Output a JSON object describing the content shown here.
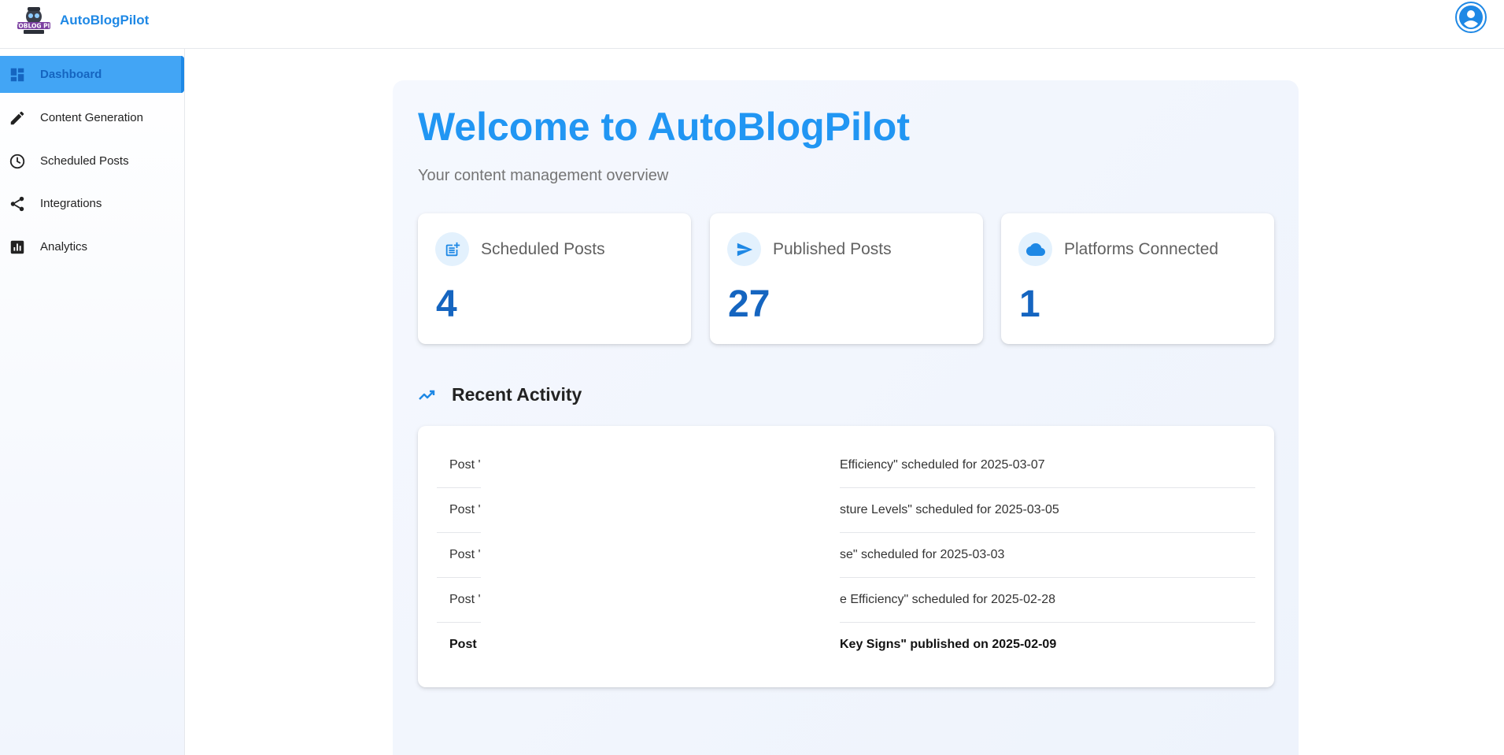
{
  "app": {
    "name": "AutoBlogPilot",
    "logo_text": "AUTOBLOG PILOT"
  },
  "icons": {
    "logo": "robot-pilot-logo",
    "account": "account-circle-icon",
    "dashboard": "dashboard-icon",
    "content_generation": "pencil-icon",
    "scheduled_posts": "clock-icon",
    "integrations": "share-icon",
    "analytics": "analytics-icon",
    "scheduled_stat": "post-add-icon",
    "published_stat": "send-icon",
    "platforms_stat": "cloud-icon",
    "recent_activity": "trending-up-icon"
  },
  "colors": {
    "accent": "#2196f3",
    "accent_dark": "#1565c0",
    "active_nav_bg": "#42a5f5",
    "badge_bg": "#e3f1fd"
  },
  "sidebar": {
    "items": [
      {
        "label": "Dashboard",
        "active": true
      },
      {
        "label": "Content Generation",
        "active": false
      },
      {
        "label": "Scheduled Posts",
        "active": false
      },
      {
        "label": "Integrations",
        "active": false
      },
      {
        "label": "Analytics",
        "active": false
      }
    ]
  },
  "main": {
    "title": "Welcome to AutoBlogPilot",
    "subtitle": "Your content management overview",
    "stats": [
      {
        "label": "Scheduled Posts",
        "value": "4"
      },
      {
        "label": "Published Posts",
        "value": "27"
      },
      {
        "label": "Platforms Connected",
        "value": "1"
      }
    ],
    "recent_activity": {
      "title": "Recent Activity",
      "rows": [
        {
          "start": "Post '",
          "end": "Efficiency\" scheduled for 2025-03-07"
        },
        {
          "start": "Post '",
          "end": "sture Levels\" scheduled for 2025-03-05"
        },
        {
          "start": "Post '",
          "end": "se\" scheduled for 2025-03-03"
        },
        {
          "start": "Post '",
          "end": "e Efficiency\" scheduled for 2025-02-28"
        },
        {
          "start": "Post",
          "end": "Key Signs\" published on 2025-02-09"
        }
      ]
    }
  }
}
